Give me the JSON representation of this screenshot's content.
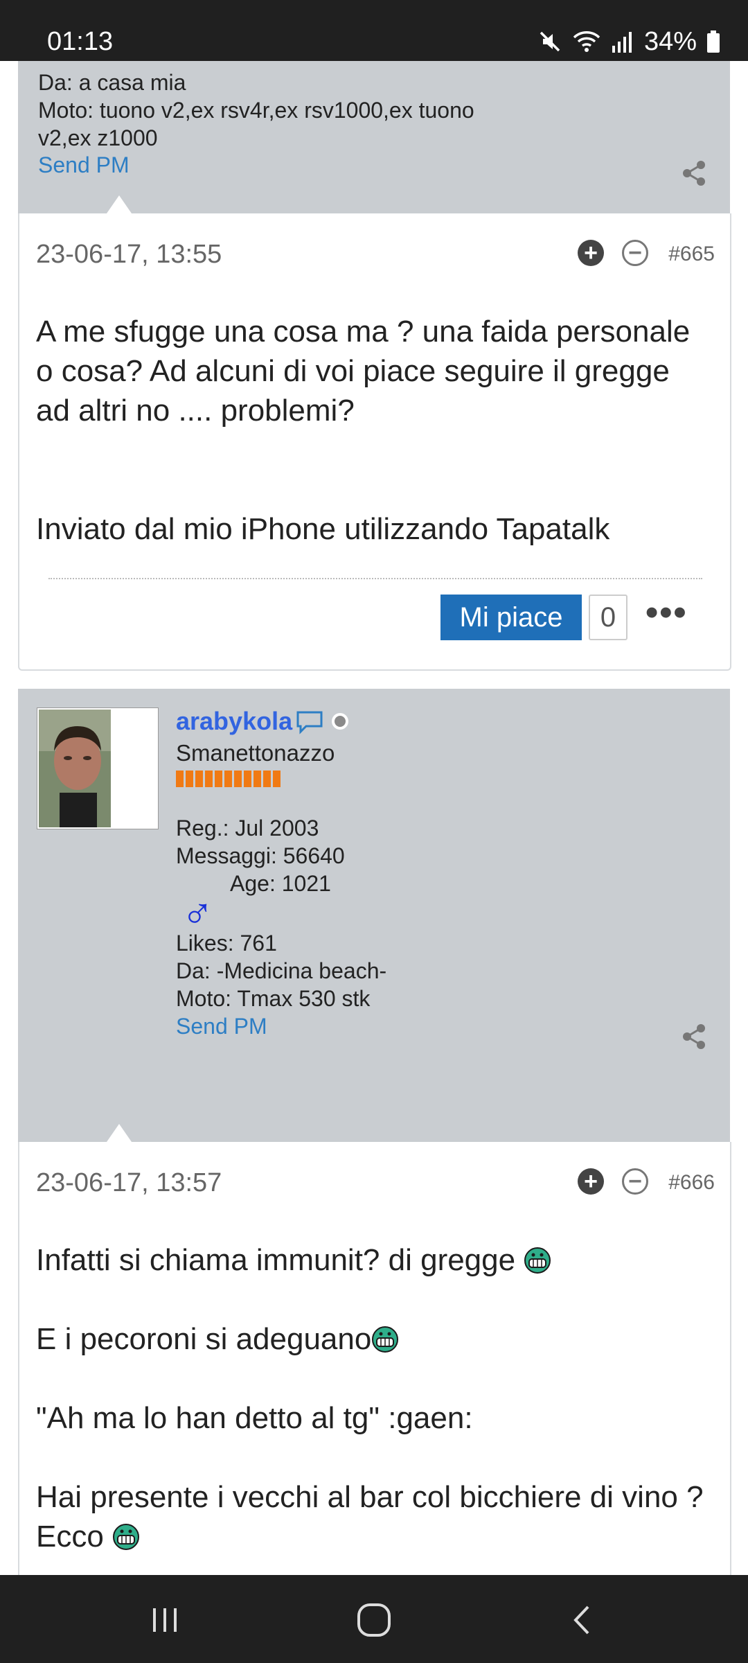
{
  "status_bar": {
    "time": "01:13",
    "battery": "34%",
    "icons": [
      "mute-icon",
      "wifi-icon",
      "signal-icon",
      "battery-icon"
    ]
  },
  "top_profile": {
    "from": "Da: a casa mia",
    "bike_line1": "Moto: tuono v2,ex rsv4r,ex rsv1000,ex tuono",
    "bike_line2": "v2,ex z1000",
    "send_pm": "Send PM"
  },
  "post_665": {
    "date": "23-06-17, 13:55",
    "number": "#665",
    "paragraph1": "A me sfugge una cosa ma ? una faida personale o cosa? Ad alcuni di voi piace seguire il gregge ad altri no .... problemi?",
    "paragraph2": "Inviato dal mio iPhone utilizzando Tapatalk",
    "like_label": "Mi piace",
    "like_count": "0",
    "more": "•••"
  },
  "profile_666": {
    "username": "arabykola",
    "title": "Smanettonazzo",
    "reg": "Reg.: Jul 2003",
    "messages": "Messaggi: 56640",
    "age": "Age: 1021",
    "gender_symbol": "♂",
    "likes": "Likes: 761",
    "from": "Da: -Medicina beach-",
    "bike": "Moto: Tmax 530 stk",
    "send_pm": "Send PM",
    "rank_color": "#f07a14"
  },
  "post_666": {
    "date": "23-06-17, 13:57",
    "number": "#666",
    "line1": "Infatti si chiama immunit? di gregge",
    "line2": "E i pecoroni si adeguano",
    "line3": "\"Ah ma lo han detto al tg\" :gaen:",
    "line4": "Hai presente i vecchi al bar col bicchiere di vino ?",
    "line5": "Ecco"
  },
  "colors": {
    "profile_bg": "#c9cdd1",
    "link": "#2d7ec4",
    "username": "#3264e0",
    "like_button": "#1f6fb8"
  }
}
